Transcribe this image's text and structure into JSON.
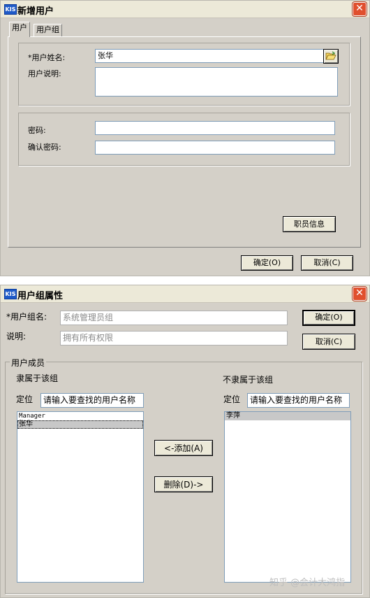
{
  "dialog1": {
    "title": "新增用户",
    "app_icon": "KIS",
    "close_glyph": "✕",
    "tabs": [
      {
        "label": "用户"
      },
      {
        "label": "用户组"
      }
    ],
    "fields": {
      "username_label": "*用户姓名:",
      "username_value": "张华",
      "desc_label": "用户说明:",
      "desc_value": "",
      "password_label": "密码:",
      "password_value": "",
      "confirm_label": "确认密码:",
      "confirm_value": ""
    },
    "browse_icon": "folder-open-icon",
    "buttons": {
      "staff_info": "职员信息",
      "ok": "确定(O)",
      "cancel": "取消(C)"
    }
  },
  "dialog2": {
    "title": "用户组属性",
    "app_icon": "KIS",
    "close_glyph": "✕",
    "group_name_label": "*用户组名:",
    "group_name_value": "系统管理员组",
    "desc_label": "说明:",
    "desc_value": "拥有所有权限",
    "buttons": {
      "ok": "确定(O)",
      "cancel": "取消(C)",
      "add": "<-添加(A)",
      "remove": "删除(D)->"
    },
    "members_group_label": "用户成员",
    "in_group": {
      "heading": "隶属于该组",
      "locate_label": "定位",
      "search_value": "请输入要查找的用户名称",
      "items": [
        {
          "text": "Manager"
        },
        {
          "text": "张华"
        }
      ]
    },
    "not_in_group": {
      "heading": "不隶属于该组",
      "locate_label": "定位",
      "search_value": "请输入要查找的用户名称",
      "items": [
        {
          "text": "李萍"
        }
      ]
    }
  },
  "watermark": "知乎 @会计大鸿指"
}
